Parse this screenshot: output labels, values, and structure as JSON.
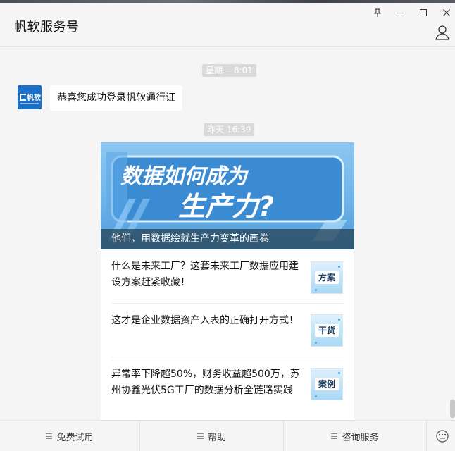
{
  "header": {
    "title": "帆软服务号"
  },
  "chat": {
    "time1": "星期一 8:01",
    "avatar_text": "帆软",
    "message1": "恭喜您成功登录帆软通行证",
    "time2": "昨天 16:39",
    "card": {
      "banner_line1": "数据如何成为",
      "banner_line2": "生产力?",
      "caption": "他们，用数据绘就生产力变革的画卷",
      "articles": [
        {
          "title": "什么是未来工厂？这套未来工厂数据应用建设方案赶紧收藏！",
          "thumb": "方案"
        },
        {
          "title": "这才是企业数据资产入表的正确打开方式！",
          "thumb": "干货"
        },
        {
          "title": "异常率下降超50%，财务收益超500万，苏州协鑫光伏5G工厂的数据分析全链路实践",
          "thumb": "案例"
        }
      ]
    }
  },
  "bottom_menu": [
    {
      "label": "免费试用"
    },
    {
      "label": "帮助"
    },
    {
      "label": "咨询服务"
    }
  ],
  "icons": [
    "pin-icon",
    "minimize-icon",
    "maximize-icon",
    "close-icon",
    "profile-icon",
    "menu-icon",
    "keyboard-icon"
  ],
  "colors": {
    "background": "#f5f5f5",
    "brand_blue": "#1b6fc6",
    "timestamp_bg": "#dadada",
    "caption_bg": "#2e5060"
  }
}
